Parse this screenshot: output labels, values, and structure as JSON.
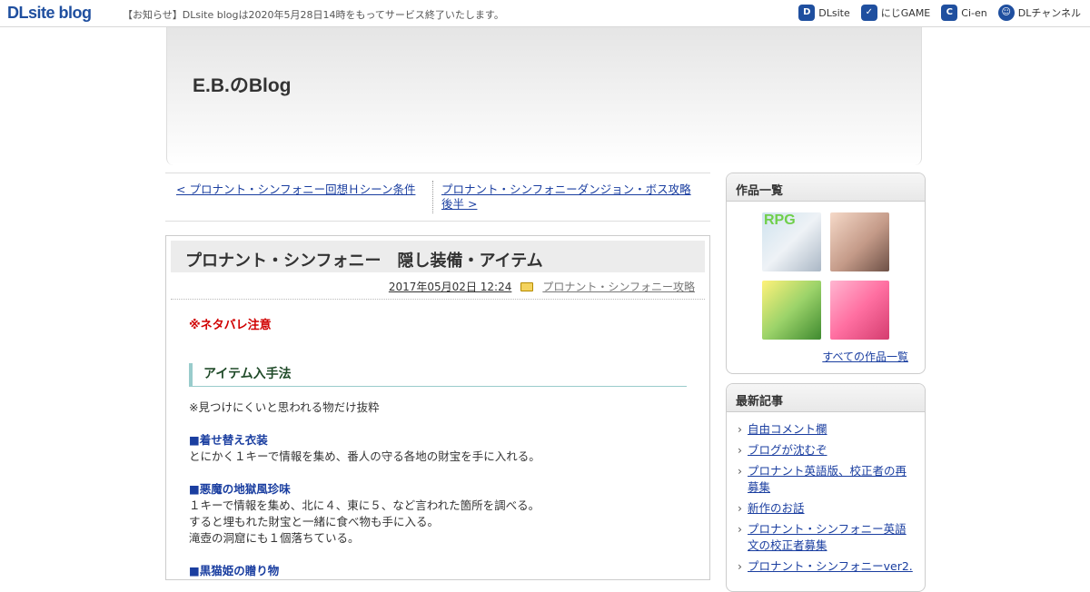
{
  "topbar": {
    "logo": "DLsite blog",
    "notice": "【お知らせ】DLsite blogは2020年5月28日14時をもってサービス終了いたします。",
    "links": [
      {
        "label": "DLsite",
        "icon": "dlsite-icon"
      },
      {
        "label": "にじGAME",
        "icon": "nijigame-icon"
      },
      {
        "label": "Ci-en",
        "icon": "cien-icon"
      },
      {
        "label": "DLチャンネル",
        "icon": "dlchannel-icon"
      }
    ]
  },
  "header": {
    "title": "E.B.のBlog"
  },
  "postnav": {
    "prev": "< プロナント・シンフォニー回想Ｈシーン条件",
    "next": "プロナント・シンフォニーダンジョン・ボス攻略後半 >"
  },
  "article": {
    "title": "プロナント・シンフォニー　隠し装備・アイテム",
    "date": "2017年05月02日 12:24",
    "category": "プロナント・シンフォニー攻略",
    "spoiler": "※ネタバレ注意",
    "heading": "アイテム入手法",
    "note": "※見つけにくいと思われる物だけ抜粋",
    "sections": [
      {
        "title": "■着せ替え衣装",
        "lines": [
          "とにかく１キーで情報を集め、番人の守る各地の財宝を手に入れる。"
        ]
      },
      {
        "title": "■悪魔の地獄風珍味",
        "lines": [
          "１キーで情報を集め、北に４、東に５、など言われた箇所を調べる。",
          "すると埋もれた財宝と一緒に食べ物も手に入る。",
          "滝壺の洞窟にも１個落ちている。"
        ]
      },
      {
        "title": "■黒猫姫の贈り物",
        "lines": []
      }
    ]
  },
  "sidebar": {
    "works": {
      "title": "作品一覧",
      "thumb_label": "RPG",
      "all_link": "すべての作品一覧"
    },
    "recent": {
      "title": "最新記事",
      "items": [
        "自由コメント欄",
        "ブログが沈むぞ",
        "プロナント英語版、校正者の再募集",
        "新作のお話",
        "プロナント・シンフォニー英語文の校正者募集",
        "プロナント・シンフォニーver2."
      ]
    }
  }
}
